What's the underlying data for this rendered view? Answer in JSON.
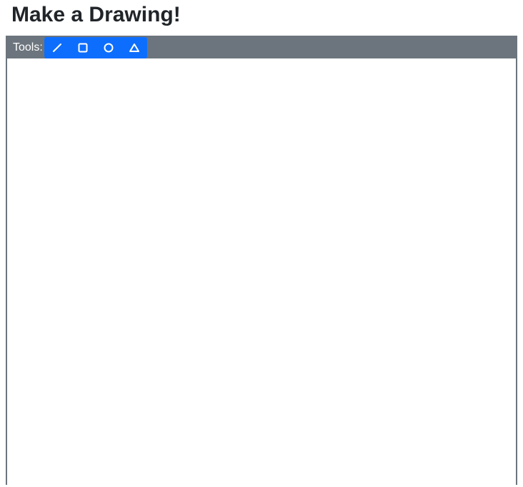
{
  "title": "Make a Drawing!",
  "toolbar": {
    "label": "Tools:",
    "tools": [
      {
        "name": "line"
      },
      {
        "name": "square"
      },
      {
        "name": "circle"
      },
      {
        "name": "triangle"
      }
    ]
  },
  "colors": {
    "toolbarBg": "#6c757d",
    "activeTool": "#0d6efd"
  }
}
